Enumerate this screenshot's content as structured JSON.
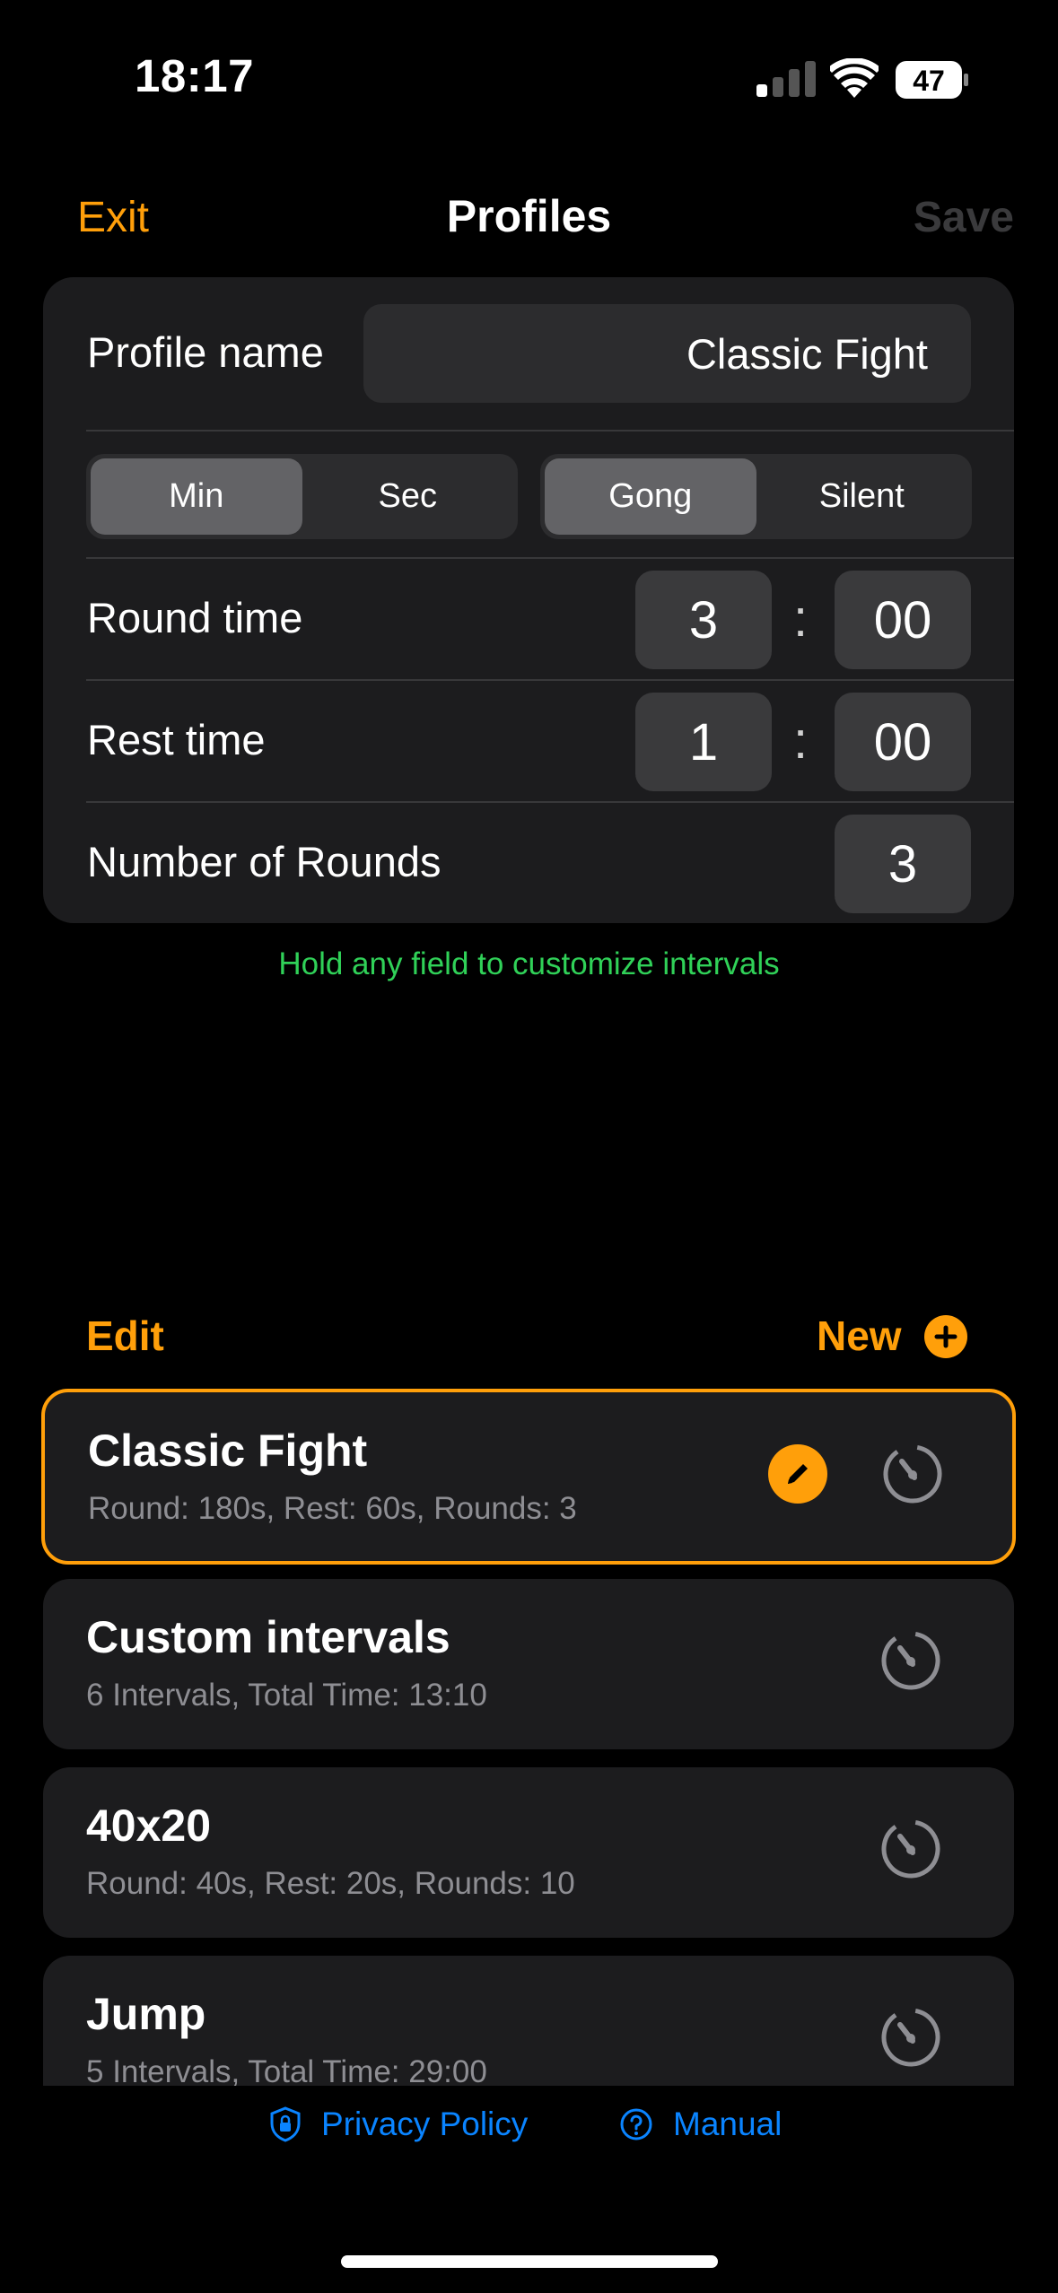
{
  "status_bar": {
    "time": "18:17",
    "battery_level": "47"
  },
  "nav": {
    "exit_label": "Exit",
    "title": "Profiles",
    "save_label": "Save"
  },
  "settings": {
    "profile_name_label": "Profile name",
    "profile_name_value": "Classic Fight",
    "unit_segment": {
      "options": [
        "Min",
        "Sec"
      ],
      "selected": "Min"
    },
    "sound_segment": {
      "options": [
        "Gong",
        "Silent"
      ],
      "selected": "Gong"
    },
    "round_time": {
      "label": "Round time",
      "minutes": "3",
      "separator": ":",
      "seconds": "00"
    },
    "rest_time": {
      "label": "Rest time",
      "minutes": "1",
      "separator": ":",
      "seconds": "00"
    },
    "rounds": {
      "label": "Number of Rounds",
      "value": "3"
    }
  },
  "hint": "Hold any field to customize intervals",
  "list_header": {
    "edit_label": "Edit",
    "new_label": "New"
  },
  "profiles": [
    {
      "name": "Classic Fight",
      "desc": "Round: 180s, Rest: 60s, Rounds: 3",
      "active": true
    },
    {
      "name": "Custom intervals",
      "desc": "6 Intervals, Total Time: 13:10",
      "active": false
    },
    {
      "name": "40x20",
      "desc": "Round: 40s, Rest: 20s, Rounds: 10",
      "active": false
    },
    {
      "name": "Jump",
      "desc": "5 Intervals, Total Time: 29:00",
      "active": false
    }
  ],
  "footer": {
    "privacy_label": "Privacy Policy",
    "manual_label": "Manual"
  },
  "colors": {
    "accent": "#ff9f0a",
    "hint_green": "#30d158",
    "link_blue": "#0a84ff",
    "card_bg": "#1c1c1e"
  }
}
